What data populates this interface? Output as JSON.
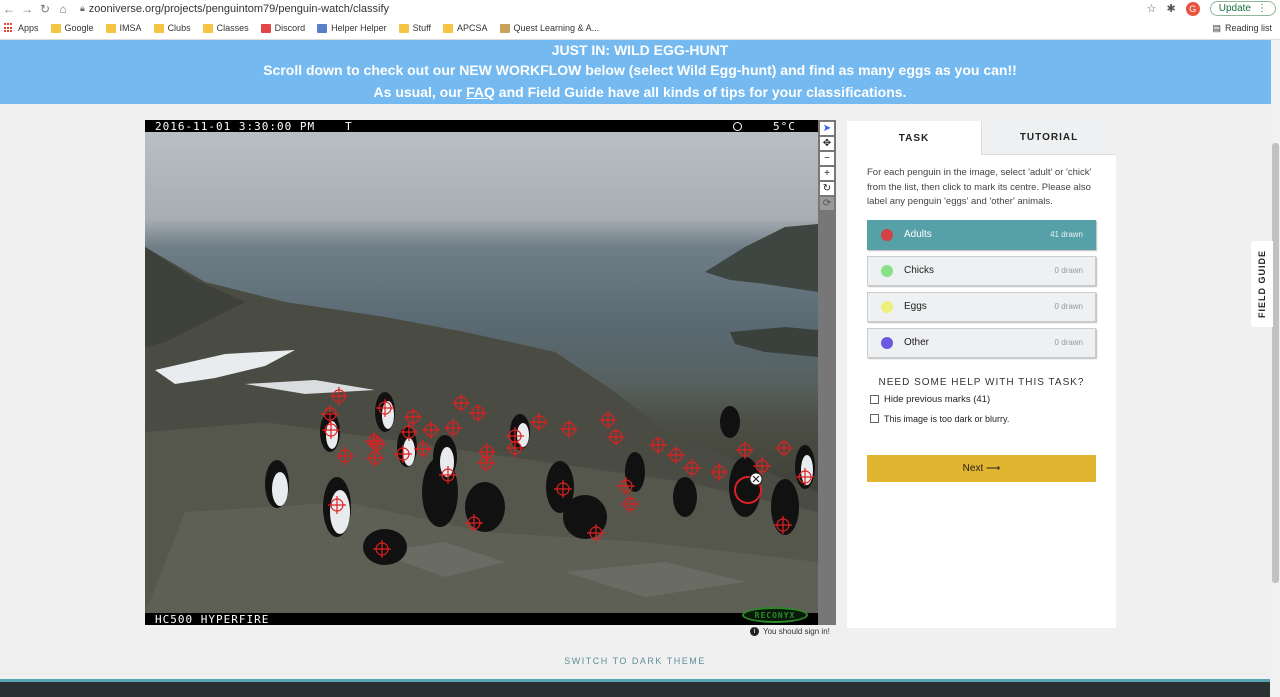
{
  "browser": {
    "url": "zooniverse.org/projects/penguintom79/penguin-watch/classify",
    "avatar_letter": "G",
    "update_label": "Update",
    "bookmarks": [
      "Apps",
      "Google",
      "IMSA",
      "Clubs",
      "Classes",
      "Discord",
      "Helper Helper",
      "Stuff",
      "APCSA",
      "Quest Learning & A..."
    ],
    "reading_list": "Reading list"
  },
  "banner": {
    "line1": "JUST IN: WILD EGG-HUNT",
    "line2": "Scroll down to check out our NEW WORKFLOW below (select Wild Egg-hunt) and find as many eggs as you can!!",
    "line3_pre": "As usual, our ",
    "line3_link": "FAQ",
    "line3_post": " and Field Guide have all kinds of tips for your classifications."
  },
  "camera": {
    "timestamp": "2016-11-01 3:30:00 PM",
    "flag": "T",
    "temperature": "5°C",
    "model": "HC500 HYPERFIRE",
    "brand": "RECONYX"
  },
  "tools": [
    "pointer-icon",
    "pan-icon",
    "zoom-out-icon",
    "zoom-in-icon",
    "rotate-icon",
    "reset-icon"
  ],
  "task": {
    "tab_task": "TASK",
    "tab_tutorial": "TUTORIAL",
    "instructions": "For each penguin in the image, select 'adult' or 'chick' from the list, then click to mark its centre. Please also label any penguin 'eggs' and 'other' animals.",
    "options": [
      {
        "label": "Adults",
        "count": "41 drawn",
        "color": "#e23a3a"
      },
      {
        "label": "Chicks",
        "count": "0 drawn",
        "color": "#7de07d"
      },
      {
        "label": "Eggs",
        "count": "0 drawn",
        "color": "#f0f070"
      },
      {
        "label": "Other",
        "count": "0 drawn",
        "color": "#5a4ae0"
      }
    ],
    "help_title": "NEED SOME HELP WITH THIS TASK?",
    "hide_marks": "Hide previous marks (41)",
    "too_dark": "This image is too dark or blurry.",
    "next": "Next ⟶"
  },
  "signin_notice": "You should sign in!",
  "field_guide": "FIELD GUIDE",
  "dark_theme": "SWITCH TO DARK THEME"
}
